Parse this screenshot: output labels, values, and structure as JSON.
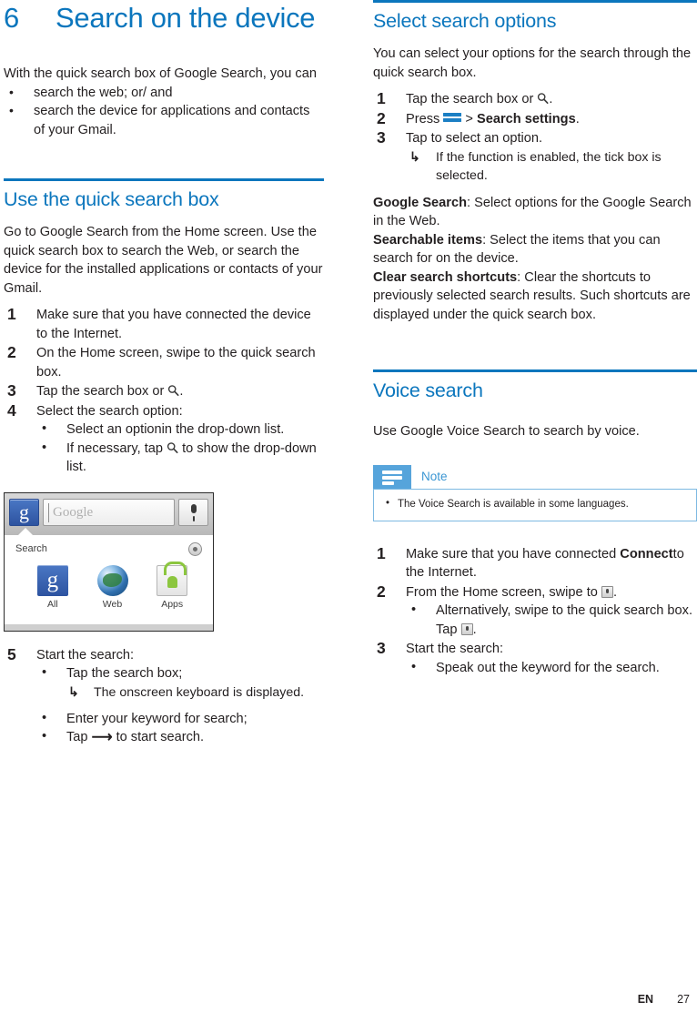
{
  "accent_color": "#0b76bd",
  "note_icon_color": "#56a4db",
  "chapter": {
    "number": "6",
    "title": "Search on the device"
  },
  "left_column": {
    "intro": {
      "paragraph": "With the quick search box of Google Search, you can",
      "bullets": [
        "search the web; or/ and",
        "search the device for applications and contacts of your Gmail."
      ]
    },
    "section_quick_search": {
      "heading": "Use the quick search box",
      "paragraph": "Go to Google Search from the Home screen. Use the quick search box to search the Web, or search the device for the installed applications or contacts of your Gmail.",
      "steps": [
        {
          "num": "1",
          "text": "Make sure that you have connected the device to the Internet."
        },
        {
          "num": "2",
          "text": "On the Home screen, swipe to the quick search box."
        },
        {
          "num": "3",
          "text_before": "Tap the search box or ",
          "icon": "search-icon",
          "text_after": "."
        },
        {
          "num": "4",
          "text": "Select the search option:",
          "sub": [
            {
              "text": "Select an optionin the drop-down list."
            },
            {
              "text_before": "If necessary, tap ",
              "icon": "search-icon",
              "text_after": " to show the drop-down list."
            }
          ]
        }
      ],
      "steps_after_figure": [
        {
          "num": "5",
          "text": "Start the search:",
          "sub": [
            {
              "text": "Tap the search box;",
              "result": "The onscreen keyboard is displayed."
            },
            {
              "text": "Enter your keyword for search;"
            },
            {
              "text_before": "Tap ",
              "icon": "arrow-right-icon",
              "text_after": " to start search."
            }
          ]
        }
      ]
    },
    "figure": {
      "name": "android-google-search-widget-screenshot",
      "search_placeholder": "Google",
      "g_badge_letter": "g",
      "panel_label": "Search",
      "icons": [
        {
          "glyph": "g",
          "caption": "All",
          "icon_name": "google-all-icon"
        },
        {
          "glyph": "",
          "caption": "Web",
          "icon_name": "globe-web-icon"
        },
        {
          "glyph": "",
          "caption": "Apps",
          "icon_name": "android-market-apps-icon"
        }
      ],
      "settings_icon": "search-settings-icon",
      "mic_icon": "microphone-icon"
    }
  },
  "right_column": {
    "section_search_options": {
      "heading": "Select search options",
      "paragraph": "You can select your options for the search through the quick search box.",
      "steps": [
        {
          "num": "1",
          "text_before": "Tap the search box or ",
          "icon": "search-icon",
          "text_after": "."
        },
        {
          "num": "2",
          "text_before": "Press ",
          "icon": "menu-icon",
          "text_mid": " > ",
          "bold_text": "Search settings",
          "text_after": "."
        },
        {
          "num": "3",
          "text": "Tap to select an option.",
          "result": "If the function is enabled, the tick box is selected."
        }
      ],
      "definitions": [
        {
          "term": "Google Search",
          "desc": ": Select options for the Google Search in the Web."
        },
        {
          "term": "Searchable items",
          "desc": ": Select the items that you can search for on the device."
        },
        {
          "term": "Clear search shortcuts",
          "desc": ": Clear the shortcuts to previously selected search results. Such shortcuts are displayed under the quick search box."
        }
      ]
    },
    "section_voice_search": {
      "heading": "Voice search",
      "paragraph": "Use Google Voice Search to search by voice.",
      "note": {
        "title": "Note",
        "items": [
          "The Voice Search is available in some languages."
        ]
      },
      "steps": [
        {
          "num": "1",
          "text_before": "Make sure that you have connected ",
          "bold_text": "Connect",
          "text_after": "to the Internet."
        },
        {
          "num": "2",
          "text_before": "From the Home screen, swipe to ",
          "icon": "voice-search-icon",
          "text_after": ".",
          "sub": [
            {
              "text_before": "Alternatively, swipe to the quick search box. Tap ",
              "icon": "voice-search-icon",
              "text_after": "."
            }
          ]
        },
        {
          "num": "3",
          "text": "Start the search:",
          "sub": [
            {
              "text": "Speak out the keyword for the search."
            }
          ]
        }
      ]
    }
  },
  "footer": {
    "language": "EN",
    "page_number": "27"
  }
}
